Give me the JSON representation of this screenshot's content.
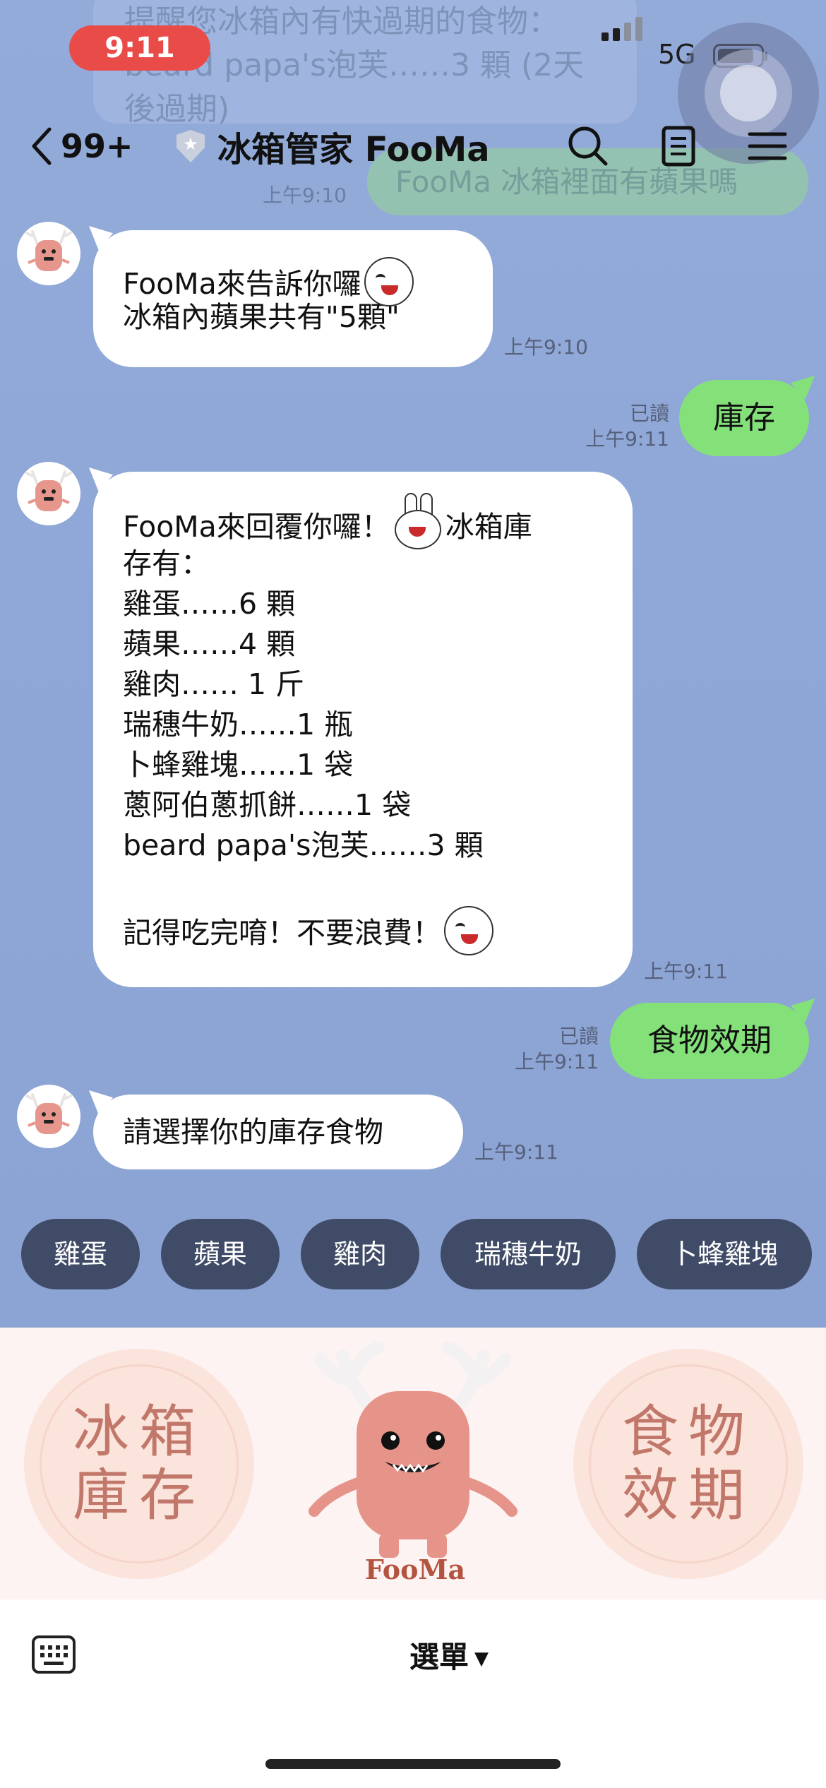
{
  "status_bar": {
    "time": "9:11",
    "network": "5G"
  },
  "ghost": {
    "notification_lines": [
      "提醒您冰箱內有快過期的食物：",
      "beard papa's泡芙……3 顆 (2天",
      "後過期)"
    ],
    "previous_message": "FooMa 冰箱裡面有蘋果嗎",
    "previous_time": "上午9:10"
  },
  "header": {
    "unread_count": "99+",
    "title": "冰箱管家 FooMa"
  },
  "messages": {
    "m1": {
      "lines": [
        "FooMa來告訴你囉",
        "冰箱內蘋果共有\"5顆\""
      ],
      "time": "上午9:10"
    },
    "m2": {
      "text": "庫存",
      "read": "已讀",
      "time": "上午9:11"
    },
    "m3": {
      "lines": [
        "FooMa來回覆你囉！",
        "冰箱庫",
        "存有：",
        "雞蛋……6 顆",
        "蘋果……4 顆",
        "雞肉…… 1 斤",
        "瑞穗牛奶……1 瓶",
        "卜蜂雞塊……1 袋",
        "蔥阿伯蔥抓餅……1 袋",
        "beard papa's泡芙……3 顆",
        "",
        "記得吃完唷！不要浪費！"
      ],
      "time": "上午9:11"
    },
    "m4": {
      "text": "食物效期",
      "read": "已讀",
      "time": "上午9:11"
    },
    "m5": {
      "text": "請選擇你的庫存食物",
      "time": "上午9:11"
    }
  },
  "quick_replies": [
    "雞蛋",
    "蘋果",
    "雞肉",
    "瑞穗牛奶",
    "卜蜂雞塊"
  ],
  "rich_menu": {
    "left": {
      "line1": "冰箱",
      "line2": "庫存"
    },
    "right": {
      "line1": "食物",
      "line2": "效期"
    },
    "logo": "FooMa"
  },
  "bottom_bar": {
    "menu_label": "選單"
  },
  "colors": {
    "chat_bg": "#8fa9d8",
    "bubble_out": "#84e17a",
    "quick_reply": "#3f4b67",
    "rich_menu_text": "#c1776a"
  }
}
